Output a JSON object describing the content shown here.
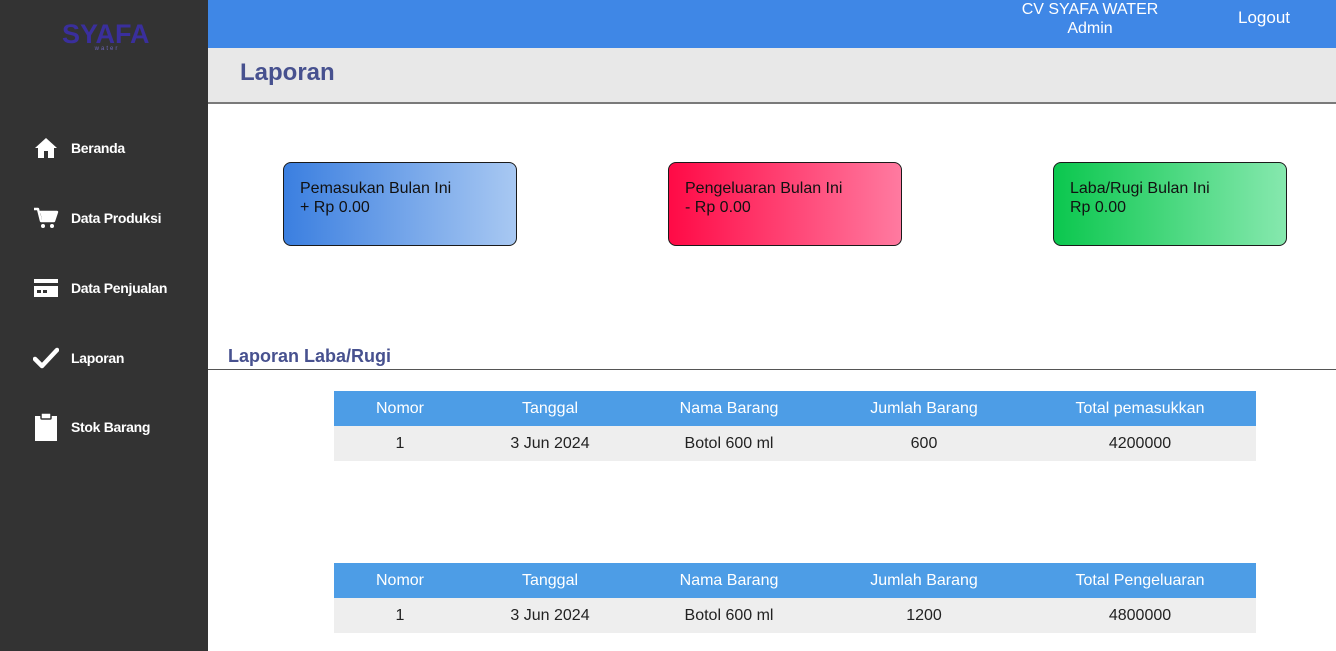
{
  "brand": {
    "logo_text": "SYAFA",
    "logo_sub": "water"
  },
  "topbar": {
    "company": "CV SYAFA WATER",
    "role": "Admin",
    "logout": "Logout"
  },
  "sidebar": {
    "items": [
      {
        "label": "Beranda",
        "icon": "home-icon"
      },
      {
        "label": "Data Produksi",
        "icon": "cart-icon"
      },
      {
        "label": "Data Penjualan",
        "icon": "card-icon"
      },
      {
        "label": "Laporan",
        "icon": "check-icon"
      },
      {
        "label": "Stok Barang",
        "icon": "clipboard-icon"
      }
    ]
  },
  "page": {
    "title": "Laporan"
  },
  "cards": {
    "income": {
      "title": "Pemasukan Bulan Ini",
      "value": "+ Rp 0.00"
    },
    "expense": {
      "title": "Pengeluaran Bulan Ini",
      "value": "- Rp 0.00"
    },
    "profit": {
      "title": "Laba/Rugi Bulan Ini",
      "value": "Rp 0.00"
    }
  },
  "section": {
    "title": "Laporan Laba/Rugi"
  },
  "income_table": {
    "headers": [
      "Nomor",
      "Tanggal",
      "Nama Barang",
      "Jumlah Barang",
      "Total pemasukkan"
    ],
    "rows": [
      [
        "1",
        "3 Jun 2024",
        "Botol 600 ml",
        "600",
        "4200000"
      ]
    ]
  },
  "expense_table": {
    "headers": [
      "Nomor",
      "Tanggal",
      "Nama Barang",
      "Jumlah Barang",
      "Total Pengeluaran"
    ],
    "rows": [
      [
        "1",
        "3 Jun 2024",
        "Botol 600 ml",
        "1200",
        "4800000"
      ]
    ]
  },
  "colors": {
    "topbar": "#3f87e6",
    "sidebar": "#333333",
    "table_header": "#4d9de6",
    "title": "#47518f"
  }
}
